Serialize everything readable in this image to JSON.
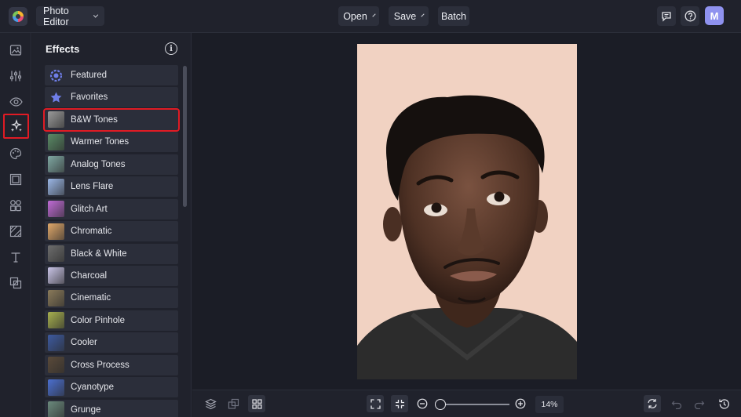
{
  "topbar": {
    "app_menu_label": "Photo Editor",
    "open_label": "Open",
    "save_label": "Save",
    "batch_label": "Batch",
    "avatar_initial": "M"
  },
  "panel": {
    "title": "Effects",
    "items": [
      {
        "label": "Featured",
        "icon": "featured-icon",
        "color": "#6f7ee8"
      },
      {
        "label": "Favorites",
        "icon": "star-icon",
        "color": "#6f7ee8"
      },
      {
        "label": "B&W Tones",
        "icon": "bw-tones-thumb",
        "color": "#9a9a9a",
        "selected": true
      },
      {
        "label": "Warmer Tones",
        "icon": "warmer-tones-thumb",
        "color": "#5a8b66"
      },
      {
        "label": "Analog Tones",
        "icon": "analog-tones-thumb",
        "color": "#7fa8a3"
      },
      {
        "label": "Lens Flare",
        "icon": "lens-flare-thumb",
        "color": "#9bb7e6"
      },
      {
        "label": "Glitch Art",
        "icon": "glitch-art-thumb",
        "color": "#c06bd6"
      },
      {
        "label": "Chromatic",
        "icon": "chromatic-thumb",
        "color": "#e0a86a"
      },
      {
        "label": "Black & White",
        "icon": "black-white-thumb",
        "color": "#6d6d6d"
      },
      {
        "label": "Charcoal",
        "icon": "charcoal-thumb",
        "color": "#c9c4e6"
      },
      {
        "label": "Cinematic",
        "icon": "cinematic-thumb",
        "color": "#8a7a5a"
      },
      {
        "label": "Color Pinhole",
        "icon": "color-pinhole-thumb",
        "color": "#a7b04f"
      },
      {
        "label": "Cooler",
        "icon": "cooler-thumb",
        "color": "#3d5aa0"
      },
      {
        "label": "Cross Process",
        "icon": "cross-process-thumb",
        "color": "#5a4a3a"
      },
      {
        "label": "Cyanotype",
        "icon": "cyanotype-thumb",
        "color": "#4b6fd0"
      },
      {
        "label": "Grunge",
        "icon": "grunge-thumb",
        "color": "#6b8a7d"
      }
    ]
  },
  "zoom": {
    "value": "14%",
    "fraction": 0.14
  },
  "colors": {
    "accent_highlight": "#e01b24",
    "avatar_bg": "#8f92ef",
    "photo_bg": "#f1d2c2"
  }
}
